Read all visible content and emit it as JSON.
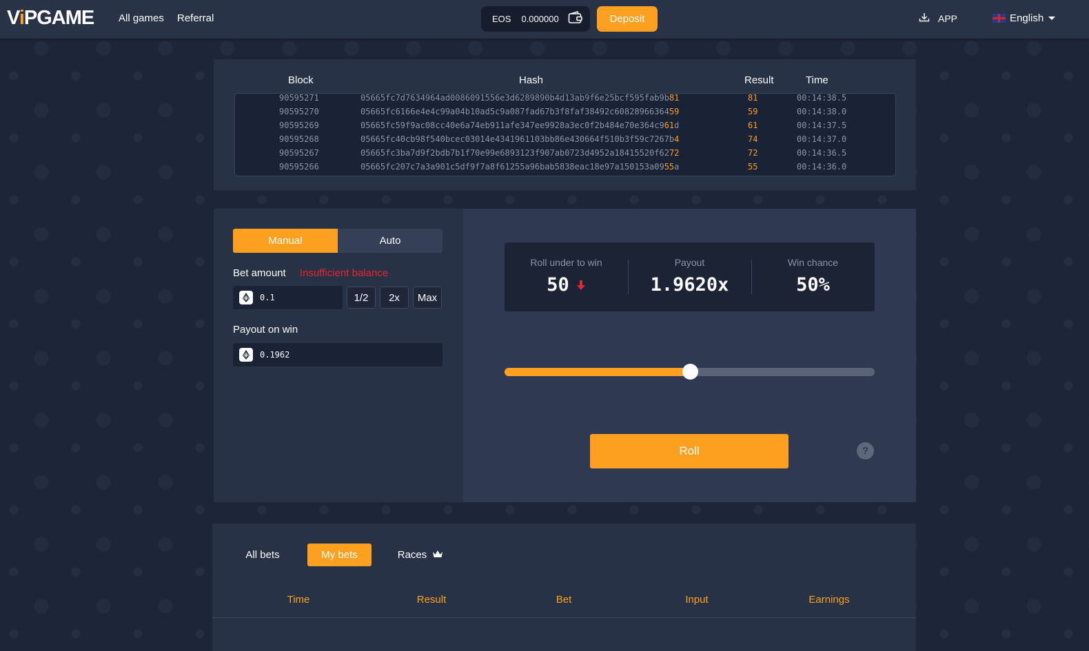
{
  "nav": {
    "logo_main": "V",
    "logo_accent": "i",
    "logo_rest": "PGAME",
    "links": [
      "All games",
      "Referral"
    ],
    "balance_currency": "EOS",
    "balance_amount": "0.000000",
    "deposit_label": "Deposit",
    "app_label": "APP",
    "language": "English"
  },
  "hash_table": {
    "headers": {
      "block": "Block",
      "hash": "Hash",
      "result": "Result",
      "time": "Time"
    },
    "rows": [
      {
        "block": "90595271",
        "hash_pre": "05665fc7d7634964ad0086091556e3d6289890b4d13ab9f6e25bcf595fab9b",
        "hash_hl": "81",
        "hash_post": "",
        "result": "81",
        "time": "00:14:38.5"
      },
      {
        "block": "90595270",
        "hash_pre": "05665fc6166e4e4c99a04b10ad5c9a087fad67b3f8faf38492c60828966364",
        "hash_hl": "59",
        "hash_post": "",
        "result": "59",
        "time": "00:14:38.0"
      },
      {
        "block": "90595269",
        "hash_pre": "05665fc59f9ac08cc40e6a74eb911afe347ee9928a3ec0f2b484e70e364c9",
        "hash_hl": "61",
        "hash_post": "d",
        "result": "61",
        "time": "00:14:37.5"
      },
      {
        "block": "90595268",
        "hash_pre": "05665fc40cb98f540bcec03014e4341961103bb86e430664f510b3f59c7267b",
        "hash_hl": "4",
        "hash_post": "",
        "result": "74",
        "time": "00:14:37.0"
      },
      {
        "block": "90595267",
        "hash_pre": "05665fc3ba7d9f2bdb7b1f70e99e6893123f907ab0723d4952a18415520f62",
        "hash_hl": "72",
        "hash_post": "",
        "result": "72",
        "time": "00:14:36.5"
      },
      {
        "block": "90595266",
        "hash_pre": "05665fc207c7a3a901c5df9f7a8f61255a96bab5838eac18e97a150153a09",
        "hash_hl": "55",
        "hash_post": "a",
        "result": "55",
        "time": "00:14:36.0"
      }
    ]
  },
  "game": {
    "tabs": [
      "Manual",
      "Auto"
    ],
    "active_tab": "Manual",
    "bet_amount_label": "Bet amount",
    "warning": "Insufficient balance",
    "bet_amount_value": "0.1",
    "half_label": "1/2",
    "double_label": "2x",
    "max_label": "Max",
    "payout_on_win_label": "Payout on win",
    "payout_on_win_value": "0.1962",
    "roll_under_label": "Roll under to win",
    "roll_under_value": "50",
    "payout_label": "Payout",
    "payout_value": "1.9620x",
    "win_chance_label": "Win chance",
    "win_chance_value": "50%",
    "slider_percent": 50,
    "roll_label": "Roll",
    "help_label": "?"
  },
  "bets": {
    "tabs": [
      "All bets",
      "My bets",
      "Races"
    ],
    "active_tab": "My bets",
    "columns": [
      "Time",
      "Result",
      "Bet",
      "Input",
      "Earnings"
    ]
  },
  "colors": {
    "accent": "#fda01f",
    "warning": "#e5262c",
    "background": "#1d2638",
    "panel": "#283246"
  }
}
